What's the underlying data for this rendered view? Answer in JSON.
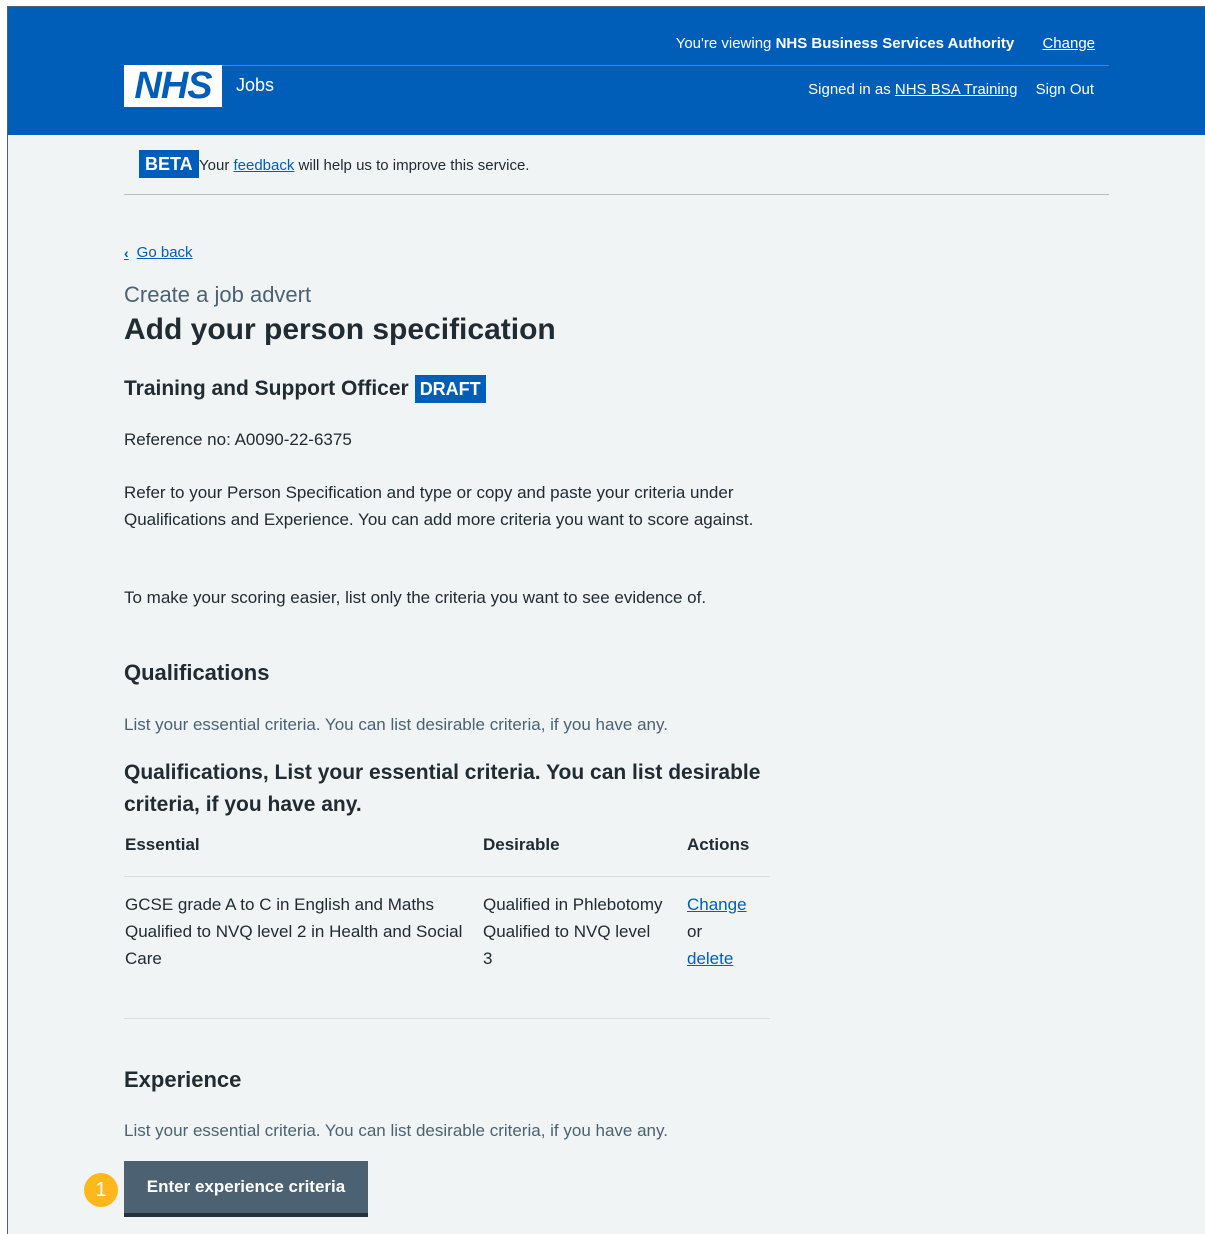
{
  "header": {
    "org_prefix": "You're viewing",
    "org_name": "NHS Business Services Authority",
    "org_change": "Change",
    "logo_text": "NHS",
    "service_name": "Jobs",
    "signed_in_prefix": "Signed in as",
    "user_name": "NHS BSA Training",
    "sign_out": "Sign Out"
  },
  "beta": {
    "tag": "BETA",
    "text_before": "Your",
    "link": "feedback",
    "text_after": "will help us to improve this service."
  },
  "nav": {
    "back": "Go back"
  },
  "page": {
    "caption": "Create a job advert",
    "title": "Add your person specification",
    "job_title": "Training and Support Officer",
    "status_tag": "DRAFT",
    "reference": "Reference no: A0090-22-6375",
    "intro_1": "Refer to your Person Specification and type or copy and paste your criteria under Qualifications and Experience. You can add more criteria you want to score against.",
    "intro_2": "To make your scoring easier, list only the criteria you want to see evidence of."
  },
  "qualifications": {
    "heading": "Qualifications",
    "hint": "List your essential criteria. You can list desirable criteria, if you have any.",
    "table_caption": "Qualifications, List your essential criteria. You can list desirable criteria, if you have any.",
    "columns": [
      "Essential",
      "Desirable",
      "Actions"
    ],
    "row": {
      "essential_1": "GCSE grade A to C in English and Maths",
      "essential_2": "Qualified to NVQ level 2 in Health and Social Care",
      "desirable_1": "Qualified in Phlebotomy",
      "desirable_2": "Qualified to NVQ level 3",
      "action_change": "Change",
      "action_or": "or",
      "action_delete": "delete"
    }
  },
  "experience": {
    "heading": "Experience",
    "hint": "List your essential criteria. You can list desirable criteria, if you have any.",
    "button": "Enter experience criteria"
  },
  "annotation": {
    "marker": "1",
    "marker_color": "#ffb81c"
  },
  "colors": {
    "brand": "#005eb8",
    "button": "#4c6272",
    "background": "#f0f4f5"
  }
}
